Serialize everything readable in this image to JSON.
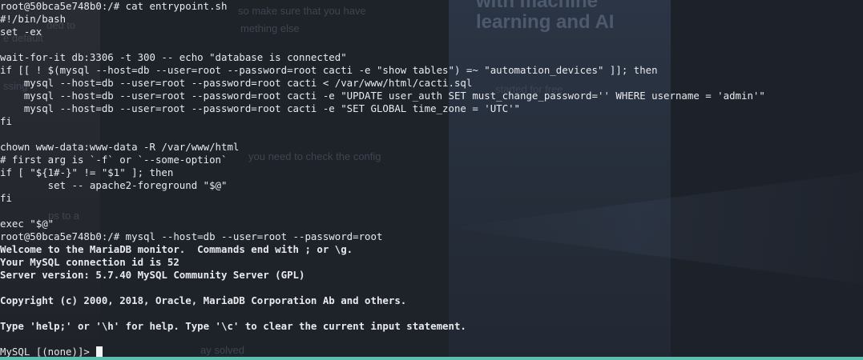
{
  "background_page": {
    "hero_lines": [
      "with machine",
      "learning and AI"
    ],
    "fragments": [
      "so make sure that you have",
      "mething else",
      "ded to",
      "e default",
      "started for free",
      "ssing",
      "you need to check the config",
      "ps to a",
      "ay solved"
    ]
  },
  "terminal": {
    "lines": [
      {
        "text": "root@50bca5e748b0:/# cat entrypoint.sh",
        "bold": false
      },
      {
        "text": "#!/bin/bash",
        "bold": false
      },
      {
        "text": "set -ex",
        "bold": false
      },
      {
        "text": "",
        "bold": false
      },
      {
        "text": "wait-for-it db:3306 -t 300 -- echo \"database is connected\"",
        "bold": false
      },
      {
        "text": "if [[ ! $(mysql --host=db --user=root --password=root cacti -e \"show tables\") =~ \"automation_devices\" ]]; then",
        "bold": false
      },
      {
        "text": "    mysql --host=db --user=root --password=root cacti < /var/www/html/cacti.sql",
        "bold": false
      },
      {
        "text": "    mysql --host=db --user=root --password=root cacti -e \"UPDATE user_auth SET must_change_password='' WHERE username = 'admin'\"",
        "bold": false
      },
      {
        "text": "    mysql --host=db --user=root --password=root cacti -e \"SET GLOBAL time_zone = 'UTC'\"",
        "bold": false
      },
      {
        "text": "fi",
        "bold": false
      },
      {
        "text": "",
        "bold": false
      },
      {
        "text": "chown www-data:www-data -R /var/www/html",
        "bold": false
      },
      {
        "text": "# first arg is `-f` or `--some-option`",
        "bold": false
      },
      {
        "text": "if [ \"${1#-}\" != \"$1\" ]; then",
        "bold": false
      },
      {
        "text": "        set -- apache2-foreground \"$@\"",
        "bold": false
      },
      {
        "text": "fi",
        "bold": false
      },
      {
        "text": "",
        "bold": false
      },
      {
        "text": "exec \"$@\"",
        "bold": false
      },
      {
        "text": "root@50bca5e748b0:/# mysql --host=db --user=root --password=root",
        "bold": false
      },
      {
        "text": "Welcome to the MariaDB monitor.  Commands end with ; or \\g.",
        "bold": true
      },
      {
        "text": "Your MySQL connection id is 52",
        "bold": true
      },
      {
        "text": "Server version: 5.7.40 MySQL Community Server (GPL)",
        "bold": true
      },
      {
        "text": "",
        "bold": false
      },
      {
        "text": "Copyright (c) 2000, 2018, Oracle, MariaDB Corporation Ab and others.",
        "bold": true
      },
      {
        "text": "",
        "bold": false
      },
      {
        "text": "Type 'help;' or '\\h' for help. Type '\\c' to clear the current input statement.",
        "bold": true
      },
      {
        "text": "",
        "bold": false
      }
    ],
    "prompt": "MySQL [(none)]> "
  },
  "colors": {
    "foreground": "#e8eaee",
    "background": "#1c2028",
    "accent_bar": "#5bbfb0"
  }
}
